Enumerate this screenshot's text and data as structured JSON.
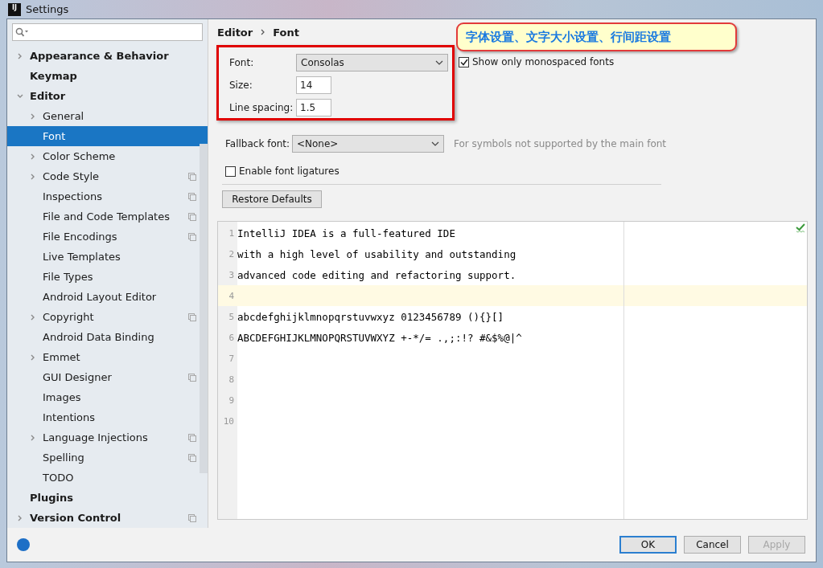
{
  "window": {
    "title": "Settings",
    "logo": "IJ"
  },
  "sidebar": {
    "items": [
      {
        "label": "Appearance & Behavior",
        "bold": true,
        "expanded": false,
        "selected": false
      },
      {
        "label": "Keymap",
        "bold": true,
        "selected": false
      },
      {
        "label": "Editor",
        "bold": true,
        "expanded": true,
        "selected": false,
        "children": [
          {
            "label": "General",
            "expanded": false,
            "selected": false
          },
          {
            "label": "Font",
            "selected": true
          },
          {
            "label": "Color Scheme",
            "expanded": false,
            "selected": false
          },
          {
            "label": "Code Style",
            "expanded": false,
            "selected": false,
            "project_level": true
          },
          {
            "label": "Inspections",
            "selected": false,
            "project_level": true
          },
          {
            "label": "File and Code Templates",
            "selected": false,
            "project_level": true
          },
          {
            "label": "File Encodings",
            "selected": false,
            "project_level": true
          },
          {
            "label": "Live Templates",
            "selected": false
          },
          {
            "label": "File Types",
            "selected": false
          },
          {
            "label": "Android Layout Editor",
            "selected": false
          },
          {
            "label": "Copyright",
            "expanded": false,
            "selected": false,
            "project_level": true
          },
          {
            "label": "Android Data Binding",
            "selected": false
          },
          {
            "label": "Emmet",
            "expanded": false,
            "selected": false
          },
          {
            "label": "GUI Designer",
            "selected": false,
            "project_level": true
          },
          {
            "label": "Images",
            "selected": false
          },
          {
            "label": "Intentions",
            "selected": false
          },
          {
            "label": "Language Injections",
            "expanded": false,
            "selected": false,
            "project_level": true
          },
          {
            "label": "Spelling",
            "selected": false,
            "project_level": true
          },
          {
            "label": "TODO",
            "selected": false
          }
        ]
      },
      {
        "label": "Plugins",
        "bold": true,
        "selected": false
      },
      {
        "label": "Version Control",
        "bold": true,
        "expanded": false,
        "selected": false,
        "project_level": true
      }
    ]
  },
  "breadcrumb": [
    "Editor",
    "Font"
  ],
  "callout": "字体设置、文字大小设置、行间距设置",
  "primary_font": {
    "label": "Font:",
    "value": "Consolas"
  },
  "size": {
    "label": "Size:",
    "value": "14"
  },
  "line_spacing": {
    "label": "Line spacing:",
    "value": "1.5"
  },
  "monospaced_checkbox": {
    "label": "Show only monospaced fonts",
    "checked": true
  },
  "fallback_font": {
    "label": "Fallback font:",
    "value": "<None>",
    "hint": "For symbols not supported by the main font"
  },
  "ligatures_checkbox": {
    "label": "Enable font ligatures",
    "checked": false
  },
  "restore_button": "Restore Defaults",
  "preview": {
    "lines": [
      {
        "number": "1",
        "text": "IntelliJ IDEA is a full-featured IDE",
        "current": false
      },
      {
        "number": "2",
        "text": "with a high level of usability and outstanding",
        "current": false
      },
      {
        "number": "3",
        "text": "advanced code editing and refactoring support.",
        "current": false
      },
      {
        "number": "4",
        "current": true
      },
      {
        "number": "5",
        "text": "abcdefghijklmnopqrstuvwxyz 0123456789 (){}[]",
        "current": false
      },
      {
        "number": "6",
        "text": "ABCDEFGHIJKLMNOPQRSTUVWXYZ +-*/= .,;:!? #&$%@|^",
        "current": false
      },
      {
        "number": "7",
        "current": false
      },
      {
        "number": "8",
        "current": false
      },
      {
        "number": "9",
        "current": false
      },
      {
        "number": "10",
        "current": false
      }
    ]
  },
  "buttons": [
    {
      "label": "OK",
      "default": true,
      "disabled": false
    },
    {
      "label": "Cancel",
      "default": false,
      "disabled": false
    },
    {
      "label": "Apply",
      "default": false,
      "disabled": true
    }
  ]
}
